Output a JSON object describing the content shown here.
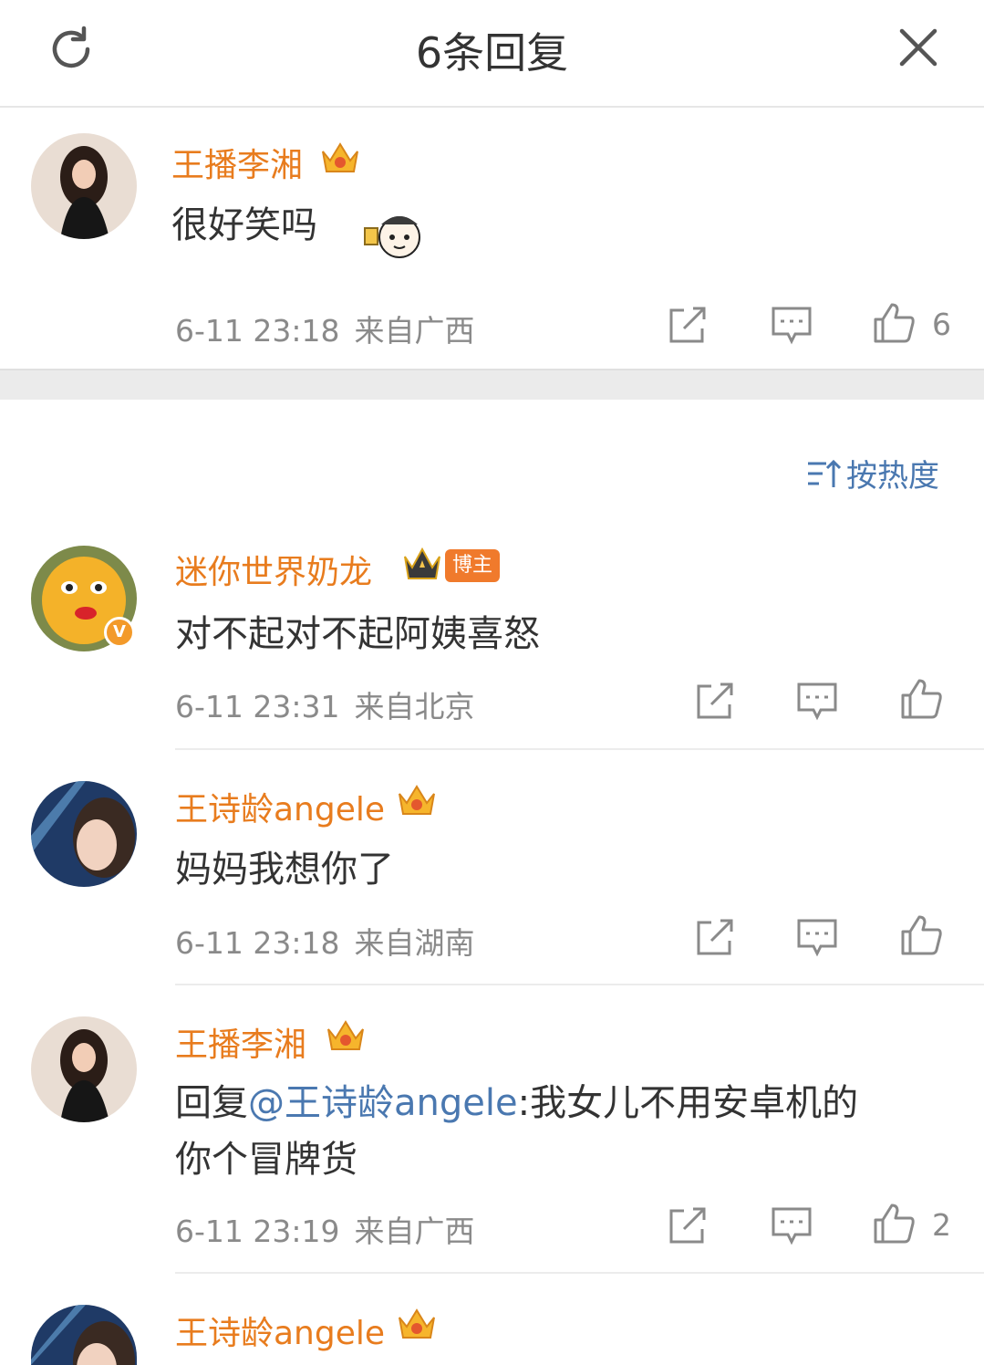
{
  "header": {
    "title": "6条回复",
    "refresh_icon": "refresh-icon",
    "close_icon": "close-icon"
  },
  "root_comment": {
    "user": "王播李湘",
    "text": "很好笑吗",
    "time": "6-11 23:18",
    "location": "来自广西",
    "likes": "6"
  },
  "sort": {
    "label": "按热度"
  },
  "replies": [
    {
      "user": "迷你世界奶龙",
      "badge": "博主",
      "verified": "V",
      "text": "对不起对不起阿姨喜怒",
      "time": "6-11 23:31",
      "location": "来自北京"
    },
    {
      "user": "王诗龄angele",
      "text": "妈妈我想你了",
      "time": "6-11 23:18",
      "location": "来自湖南"
    },
    {
      "user": "王播李湘",
      "text_prefix": "回复",
      "mention": "@王诗龄angele",
      "text_line1_rest": ":我女儿不用安卓机的",
      "text_line2": "你个冒牌货",
      "time": "6-11 23:19",
      "location": "来自广西",
      "likes": "2"
    },
    {
      "user": "王诗龄angele"
    }
  ],
  "colors": {
    "name": "#e87c1e",
    "link": "#4a78b0",
    "meta": "#8a8a8a",
    "badge": "#f07a2c"
  }
}
